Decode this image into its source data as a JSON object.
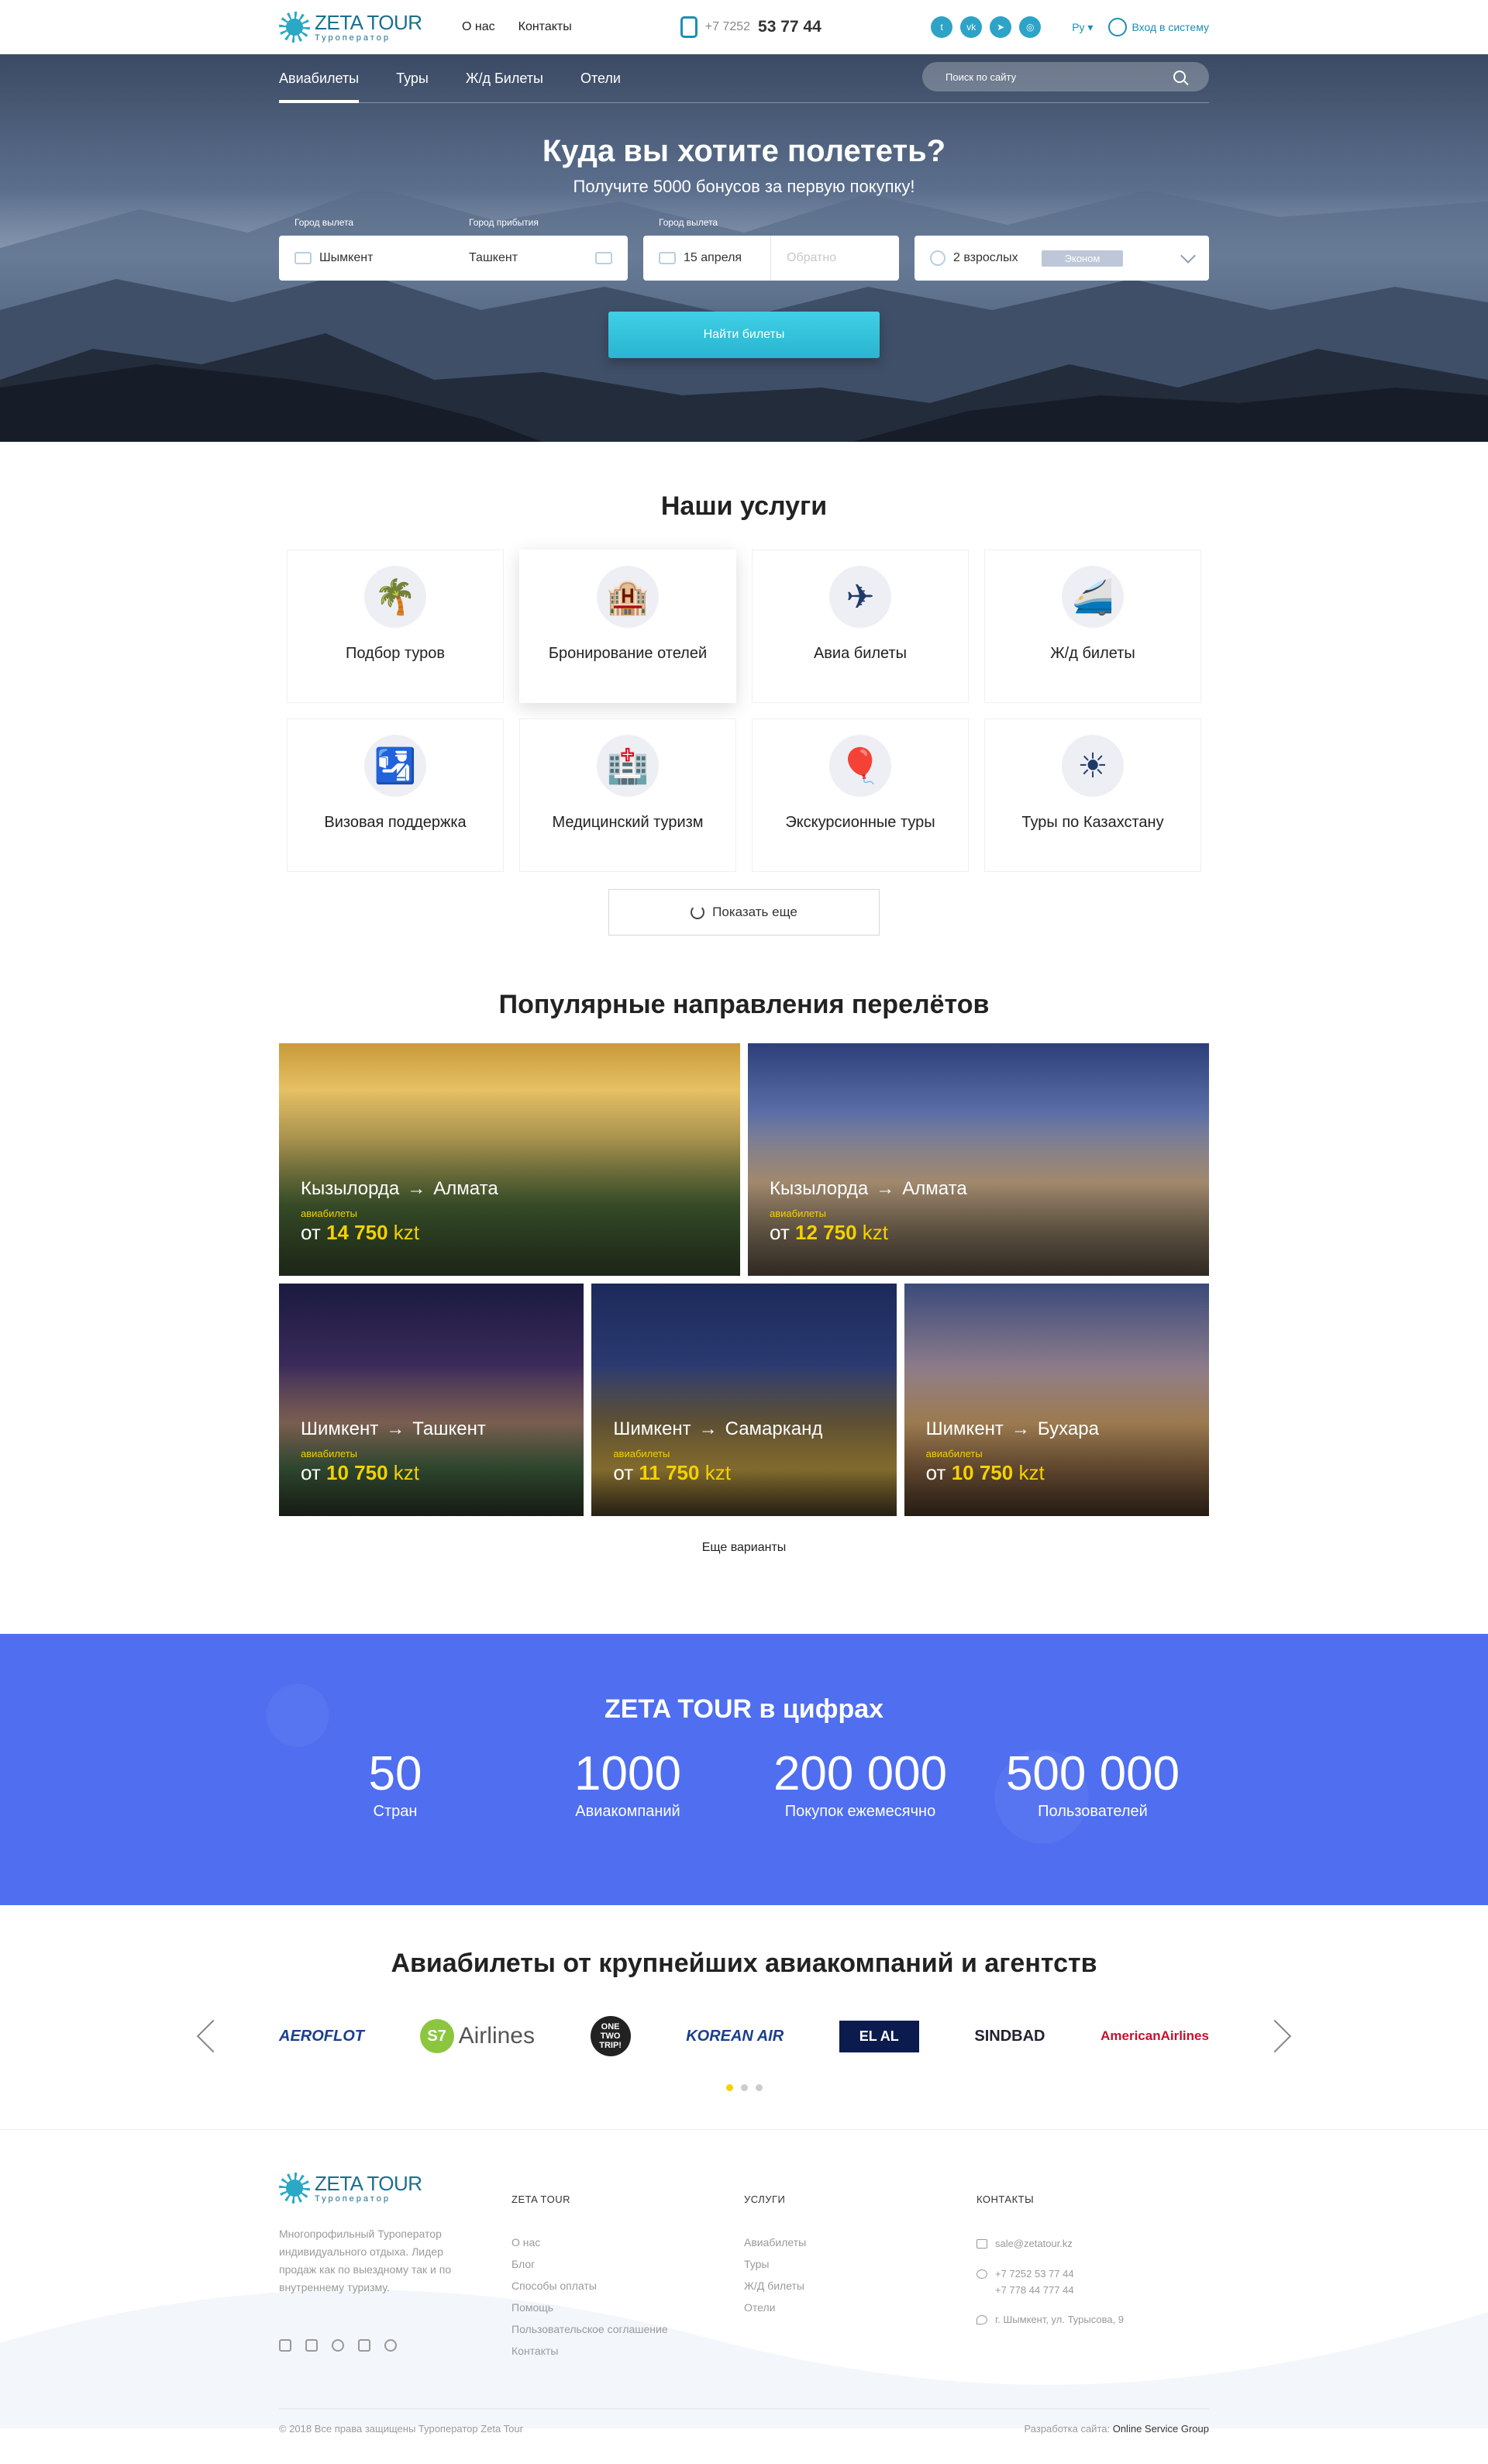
{
  "header": {
    "logo_title": "ZETA TOUR",
    "logo_sub": "Туроператор",
    "nav": [
      "О нас",
      "Контакты"
    ],
    "phone_prefix": "+7 7252",
    "phone_main": "53 77 44",
    "lang": "Ру",
    "login": "Вход в систему",
    "socials": [
      "twitter-icon",
      "vk-icon",
      "telegram-icon",
      "instagram-icon"
    ]
  },
  "hero": {
    "tabs": [
      "Авиабилеты",
      "Туры",
      "Ж/д Билеты",
      "Отели"
    ],
    "search_placeholder": "Поиск по сайту",
    "title": "Куда вы хотите полететь?",
    "subtitle": "Получите 5000 бонусов за первую покупку!",
    "from_label": "Город вылета",
    "to_label": "Город прибытия",
    "date_label": "Город вылета",
    "from_value": "Шымкент",
    "to_value": "Ташкент",
    "date_value": "15 апреля",
    "return_placeholder": "Обратно",
    "passengers": "2 взрослых",
    "class": "Эконом",
    "find_button": "Найти билеты"
  },
  "services": {
    "title": "Наши услуги",
    "items": [
      {
        "label": "Подбор туров",
        "icon": "palm-beach-icon"
      },
      {
        "label": "Бронирование отелей",
        "icon": "hotel-icon"
      },
      {
        "label": "Авиа билеты",
        "icon": "airplane-icon"
      },
      {
        "label": "Ж/д билеты",
        "icon": "train-icon"
      },
      {
        "label": "Визовая поддержка",
        "icon": "passport-icon"
      },
      {
        "label": "Медицинский туризм",
        "icon": "hospital-icon"
      },
      {
        "label": "Экскурсионные туры",
        "icon": "balloon-icon"
      },
      {
        "label": "Туры по Казахстану",
        "icon": "sun-emblem-icon"
      }
    ],
    "more_button": "Показать еще"
  },
  "destinations": {
    "title": "Популярные направления перелётов",
    "price_label": "авиабилеты",
    "currency": "kzt",
    "items": [
      {
        "from": "Кызылорда",
        "to": "Алмата",
        "price": "14 750"
      },
      {
        "from": "Кызылорда",
        "to": "Алмата",
        "price": "12 750"
      },
      {
        "from": "Шимкент",
        "to": "Ташкент",
        "price": "10 750"
      },
      {
        "from": "Шимкент",
        "to": "Самарканд",
        "price": "11 750"
      },
      {
        "from": "Шимкент",
        "to": "Бухара",
        "price": "10 750"
      }
    ],
    "price_prefix": "от",
    "more_link": "Еще варианты"
  },
  "stats": {
    "title": "ZETA TOUR в цифрах",
    "items": [
      {
        "num": "50",
        "label": "Стран"
      },
      {
        "num": "1000",
        "label": "Авиакомпаний"
      },
      {
        "num": "200 000",
        "label": "Покупок ежемесячно"
      },
      {
        "num": "500 000",
        "label": "Пользователей"
      }
    ]
  },
  "airlines": {
    "title": "Авиабилеты от крупнейших авиакомпаний и агентств",
    "logos": [
      "AEROFLOT",
      "S7",
      "Airlines",
      "ONE TWO TRIP!",
      "KOREAN AIR",
      "EL AL",
      "SINDBAD",
      "AmericanAirlines"
    ]
  },
  "footer": {
    "logo_title": "ZETA TOUR",
    "logo_sub": "Туроператор",
    "description": "Многопрофильный Туроператор индивидуального отдыха. Лидер продаж как по выездному так и по внутреннему туризму.",
    "col1_head": "ZETA TOUR",
    "col1_links": [
      "О нас",
      "Блог",
      "Способы оплаты",
      "Помощь",
      "Пользовательское соглашение",
      "Контакты"
    ],
    "col2_head": "УСЛУГИ",
    "col2_links": [
      "Авиабилеты",
      "Туры",
      "Ж/Д билеты",
      "Отели"
    ],
    "col3_head": "КОНТАКТЫ",
    "email": "sale@zetatour.kz",
    "phone1": "+7 7252 53 77 44",
    "phone2": "+7 778 44 777 44",
    "address": "г. Шымкент, ул. Турысова, 9",
    "copyright": "© 2018 Все права защищены Туроператор Zeta Tour",
    "dev_label": "Разработка сайта:",
    "dev_name": "Online Service Group"
  },
  "colors": {
    "accent": "#2ab4d0",
    "stats_bg": "#4f6ef0",
    "price": "#f5d100"
  }
}
